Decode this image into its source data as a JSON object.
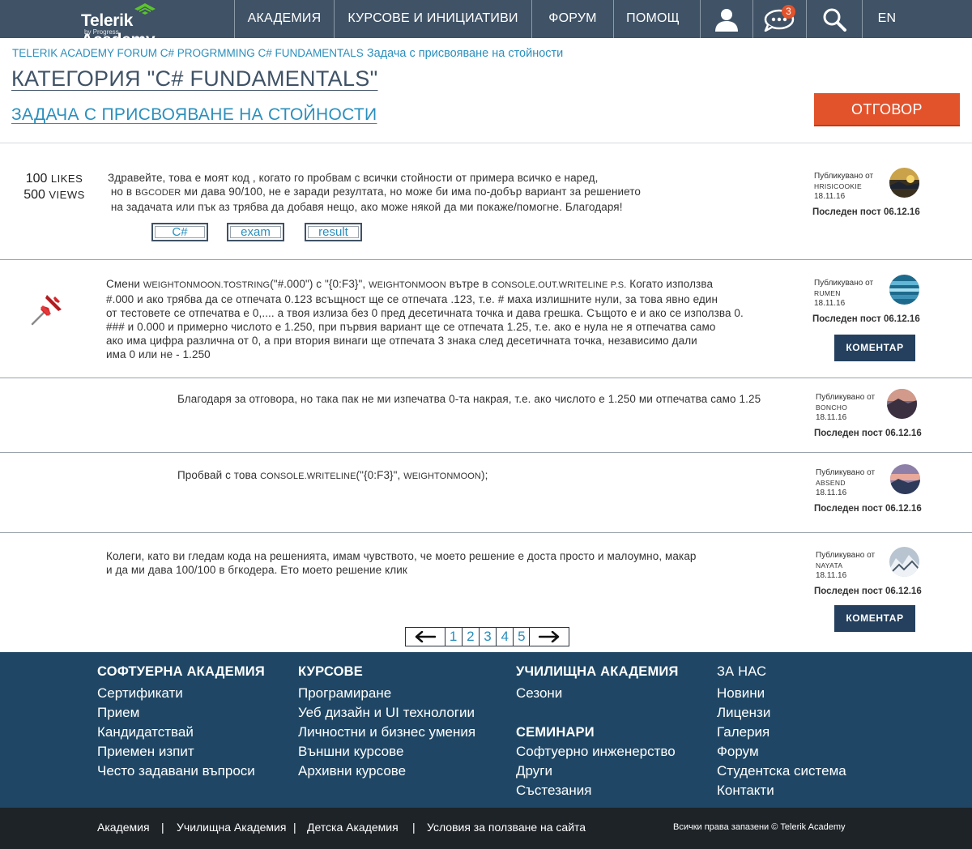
{
  "nav": {
    "logo_text": "Telerik Academy",
    "logo_sub": "by Progress",
    "items": [
      "АКАДЕМИЯ",
      "КУРСОВЕ И ИНИЦИАТИВИ",
      "ФОРУМ",
      "ПОМОЩ"
    ],
    "notifications_count": "3",
    "lang": "EN"
  },
  "breadcrumb": {
    "part1": "TELERIK ACADEMY FORUM C# PROGRMMING C# FUNDAMENTALS",
    "part2": "Задача с присвояване на стойности"
  },
  "category_title": "КАТЕГОРИЯ \"C# FUNDAMENTALS\"",
  "topic_title": "ЗАДАЧА С ПРИСВОЯВАНЕ НА СТОЙНОСТИ",
  "reply_button": "ОТГОВОР",
  "post_meta_label": "Публикувано от",
  "last_post_label": "Последен пост 06.12.16",
  "comment_button": "КОМЕНТАР",
  "first_post": {
    "likes": "100",
    "likes_label": "LIKES",
    "views": "500",
    "views_label": "VIEWS",
    "line1": "Здравейте, това е моят код , когато го пробвам с всички стойности от примера всичко е наред,",
    "line2a": " но в ",
    "line2b": "BGCODER",
    "line2c": " ми дава 90/100, не е заради резултата, но може би има по-добър вариант за решението",
    "line3": " на задачата или пък аз трябва да добавя нещо, ако може някой да ми покаже/помогне. Благодаря!",
    "tags": [
      "C#",
      "exam",
      "result"
    ]
  },
  "posts": [
    {
      "user": "HRISICOOKIE",
      "date": "18.11.16"
    },
    {
      "user": "RUMEN",
      "date": "18.11.16",
      "lines": [
        [
          "Смени ",
          "WEIGHTONMOON.TOSTRING",
          "(\"#.000\") с \"{0:F3}\", ",
          "WEIGHTONMOON",
          " вътре в ",
          "CONSOLE.OUT.WRITELINE P.S.",
          " Когато използва"
        ],
        [
          "#.000 и ако трябва да се отпечата 0.123 всъщност ще се отпечата .123, т.е. # маха излишните нули, за това явно един"
        ],
        [
          "от тестовете се отпечатва е 0,.... а твоя излиза без 0 пред десетичната точка и дава грешка. Същото е и ако се използва 0."
        ],
        [
          "### и 0.000 и примерно числото е 1.250, при първия вариант ще се отпечата 1.25, т.е. ако е нула не я отпечатва само"
        ],
        [
          "ако има цифра различна от 0, а при втория винаги ще отпечата 3 знака след десетичната точка, независимо дали"
        ],
        [
          "има 0 или не - 1.250"
        ]
      ]
    },
    {
      "user": "BONCHO",
      "date": "18.11.16",
      "text": "Благодаря за отговора, но така пак не ми изпечатва 0-та накрая, т.е. ако числото е 1.250 ми отпечатва само 1.25"
    },
    {
      "user": "ABSEND",
      "date": "18.11.16",
      "text_a": "Пробвай с това ",
      "text_b": "CONSOLE.WRITELINE",
      "text_c": "(\"{0:F3}\", ",
      "text_d": "WEIGHTONMOON",
      "text_e": ");"
    },
    {
      "user": "NAYATA",
      "date": "18.11.16",
      "line1": "Колеги, като ви гледам кода на решенията, имам чувството, че моето решение е доста просто и малоумно, макар",
      "line2": "и да ми дава 100/100 в бгкодера. Ето моето решение клик"
    }
  ],
  "pagination": [
    "1",
    "2",
    "3",
    "4",
    "5"
  ],
  "footer": {
    "col1": {
      "title": "СОФТУЕРНА АКАДЕМИЯ",
      "links": [
        "Сертификати",
        "Прием",
        "Кандидатствай",
        "Приемен изпит",
        "Често задавани въпроси"
      ]
    },
    "col2": {
      "title": "КУРСОВЕ",
      "links": [
        "Програмиране",
        "Уеб дизайн и UI технологии",
        "Личностни и бизнес умения",
        "Външни курсове",
        "Архивни курсове"
      ]
    },
    "col3": {
      "title": "УЧИЛИЩНА АКАДЕМИЯ",
      "links": [
        "Сезони"
      ],
      "title2": "СЕМИНАРИ",
      "links2": [
        "Софтуерно инженерство",
        "Други",
        "Състезания"
      ]
    },
    "col4": {
      "title": "ЗА НАС",
      "links": [
        "Новини",
        "Лицензи",
        "Галерия",
        "Форум",
        "Студентска система",
        "Контакти"
      ]
    }
  },
  "subfooter": {
    "links": [
      "Академия",
      "Училищна Академия",
      "Детска Академия",
      "Условия за ползване на сайта"
    ],
    "copyright": "Всички права запазени  ©  Telerik Academy"
  },
  "colors": {
    "nav_bg": "#3f5266",
    "accent_link": "#2a8fbd",
    "reply_button": "#e2532c",
    "comment_button": "#24405e",
    "footer_bg": "#1f4765",
    "subfooter_bg": "#1e2328"
  }
}
